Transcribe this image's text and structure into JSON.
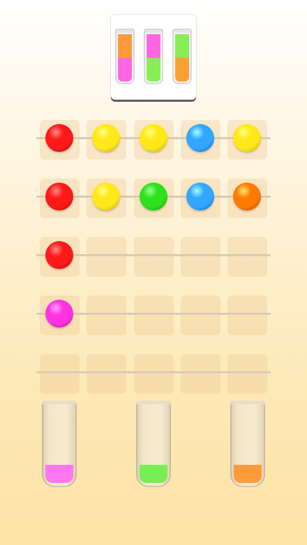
{
  "goal": {
    "tubes": [
      {
        "top": "#ff9a3c",
        "bottom": "#ff66e5"
      },
      {
        "top": "#ff66e5",
        "bottom": "#88ee55"
      },
      {
        "top": "#88ee55",
        "bottom": "#ffa033"
      }
    ]
  },
  "colors": {
    "red": "#ff1a1a",
    "yellow": "#ffe81a",
    "green": "#2fe01f",
    "blue": "#33a6ff",
    "orange": "#ff7a00",
    "magenta": "#ff33e0",
    "pink": "#ff77f0",
    "light-green": "#77ee55",
    "light-orange": "#ff9a3a"
  },
  "rows": [
    [
      "red",
      "yellow",
      "yellow",
      "blue",
      "yellow"
    ],
    [
      "red",
      "yellow",
      "green",
      "blue",
      "orange"
    ],
    [
      "red",
      null,
      null,
      null,
      null
    ],
    [
      "magenta",
      null,
      null,
      null,
      null
    ],
    [
      null,
      null,
      null,
      null,
      null
    ]
  ],
  "tubes": [
    {
      "fill": "pink"
    },
    {
      "fill": "light-green"
    },
    {
      "fill": "light-orange"
    }
  ]
}
